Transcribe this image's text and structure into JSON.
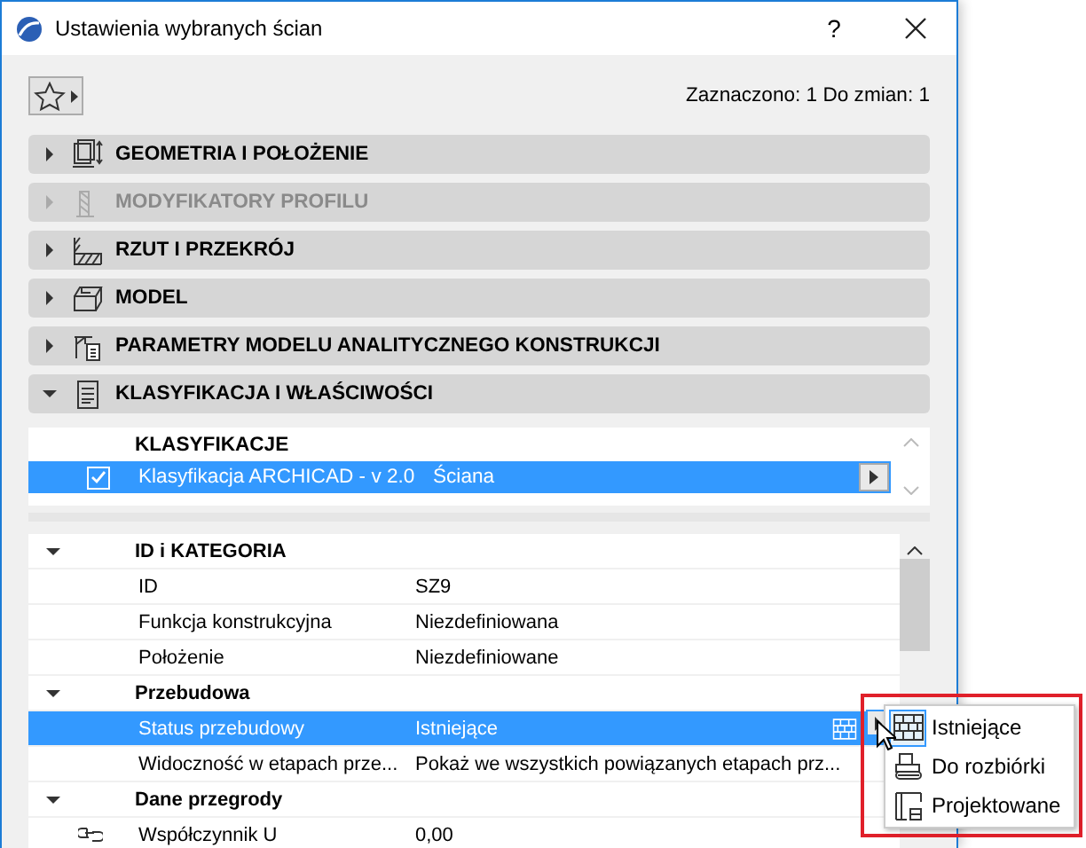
{
  "window": {
    "title": "Ustawienia wybranych ścian",
    "help": "?"
  },
  "toolbar": {
    "selection_info": "Zaznaczono: 1 Do zmian: 1"
  },
  "sections": [
    {
      "label": "GEOMETRIA I POŁOŻENIE",
      "expanded": false,
      "disabled": false
    },
    {
      "label": "MODYFIKATORY PROFILU",
      "expanded": false,
      "disabled": true
    },
    {
      "label": "RZUT I PRZEKRÓJ",
      "expanded": false,
      "disabled": false
    },
    {
      "label": "MODEL",
      "expanded": false,
      "disabled": false
    },
    {
      "label": "PARAMETRY MODELU ANALITYCZNEGO KONSTRUKCJI",
      "expanded": false,
      "disabled": false
    },
    {
      "label": "KLASYFIKACJA I WŁAŚCIWOŚCI",
      "expanded": true,
      "disabled": false
    }
  ],
  "classification": {
    "heading": "KLASYFIKACJE",
    "rows": [
      {
        "checked": true,
        "system": "Klasyfikacja ARCHICAD - v 2.0",
        "value": "Ściana",
        "selected": true
      }
    ]
  },
  "properties": {
    "groups": [
      {
        "name": "ID i KATEGORIA",
        "expanded": true,
        "rows": [
          {
            "kind": "text",
            "name": "ID",
            "value": "SZ9",
            "selected": false
          },
          {
            "kind": "text",
            "name": "Funkcja konstrukcyjna",
            "value": "Niezdefiniowana",
            "selected": false
          },
          {
            "kind": "text",
            "name": "Położenie",
            "value": "Niezdefiniowane",
            "selected": false
          }
        ]
      },
      {
        "name": "Przebudowa",
        "expanded": true,
        "rows": [
          {
            "kind": "status",
            "name": "Status przebudowy",
            "value": "Istniejące",
            "selected": true
          },
          {
            "kind": "text",
            "name": "Widoczność w etapach prze...",
            "value": "Pokaż we wszystkich powiązanych etapach prz...",
            "selected": false
          }
        ]
      },
      {
        "name": "Dane przegrody",
        "expanded": true,
        "rows": [
          {
            "kind": "linked",
            "name": "Współczynnik U",
            "value": "0,00",
            "selected": false
          }
        ]
      }
    ]
  },
  "status_menu": {
    "items": [
      {
        "label": "Istniejące",
        "selected": true
      },
      {
        "label": "Do rozbiórki",
        "selected": false
      },
      {
        "label": "Projektowane",
        "selected": false
      }
    ]
  }
}
